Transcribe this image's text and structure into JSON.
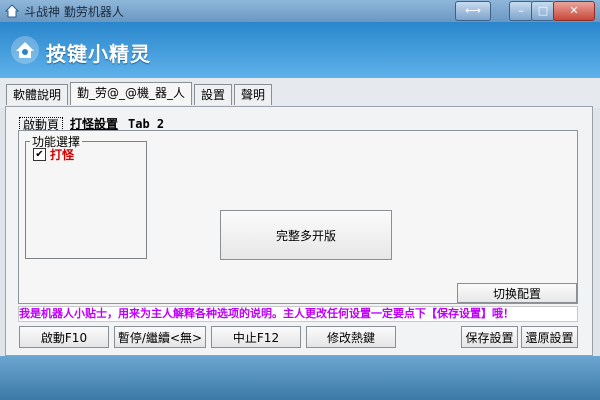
{
  "window": {
    "title": "斗战神 勤劳机器人",
    "buttons": {
      "swap": "⟷",
      "min": "–",
      "max": "□",
      "close": "✕"
    }
  },
  "header": {
    "logo_text": "按键小精灵"
  },
  "tabs": [
    {
      "label": "軟體說明"
    },
    {
      "label": "勤_劳@_@機_器_人",
      "active": true
    },
    {
      "label": "設置"
    },
    {
      "label": "聲明"
    }
  ],
  "subtabs": [
    {
      "label": "啟動頁"
    },
    {
      "label": "打怪設置"
    },
    {
      "label": "Tab 2"
    }
  ],
  "group": {
    "title": "功能選擇",
    "checkbox_label": "打怪",
    "checked": true
  },
  "center_button": "完整多开版",
  "switch_button": "切换配置",
  "tip": "我是机器人小贴士，用来为主人解释各种选项的说明。主人更改任何设置一定要点下【保存设置】哦！",
  "bottom_buttons": {
    "start": "啟動F10",
    "pause": "暫停/繼續<無>",
    "stop": "中止F12",
    "hotkey": "修改熱鍵",
    "save": "保存設置",
    "restore": "還原設置"
  },
  "colors": {
    "header": "#2a86cc",
    "tip_text": "#c000ff",
    "checkbox_label": "#d40000"
  },
  "icons": {
    "app": "house-icon",
    "logo": "house-logo-icon",
    "check": "checkmark-icon"
  }
}
